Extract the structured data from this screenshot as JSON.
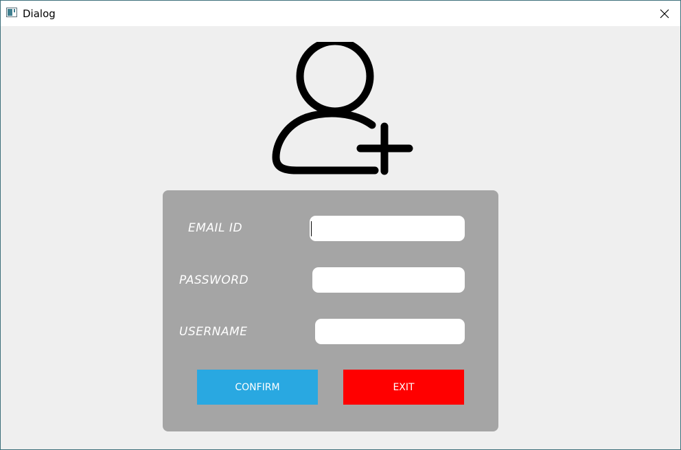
{
  "window": {
    "title": "Dialog",
    "close_icon": "close-icon",
    "app_icon": "window-app-icon"
  },
  "header": {
    "icon": "add-user-icon"
  },
  "form": {
    "email_label": "EMAIL ID",
    "email_value": "",
    "password_label": "PASSWORD",
    "password_value": "",
    "username_label": "USERNAME",
    "username_value": "",
    "confirm_label": "CONFIRM",
    "exit_label": "EXIT"
  },
  "colors": {
    "panel": "#a5a5a5",
    "confirm": "#29a8e1",
    "exit": "#ff0000",
    "background": "#efefef"
  }
}
